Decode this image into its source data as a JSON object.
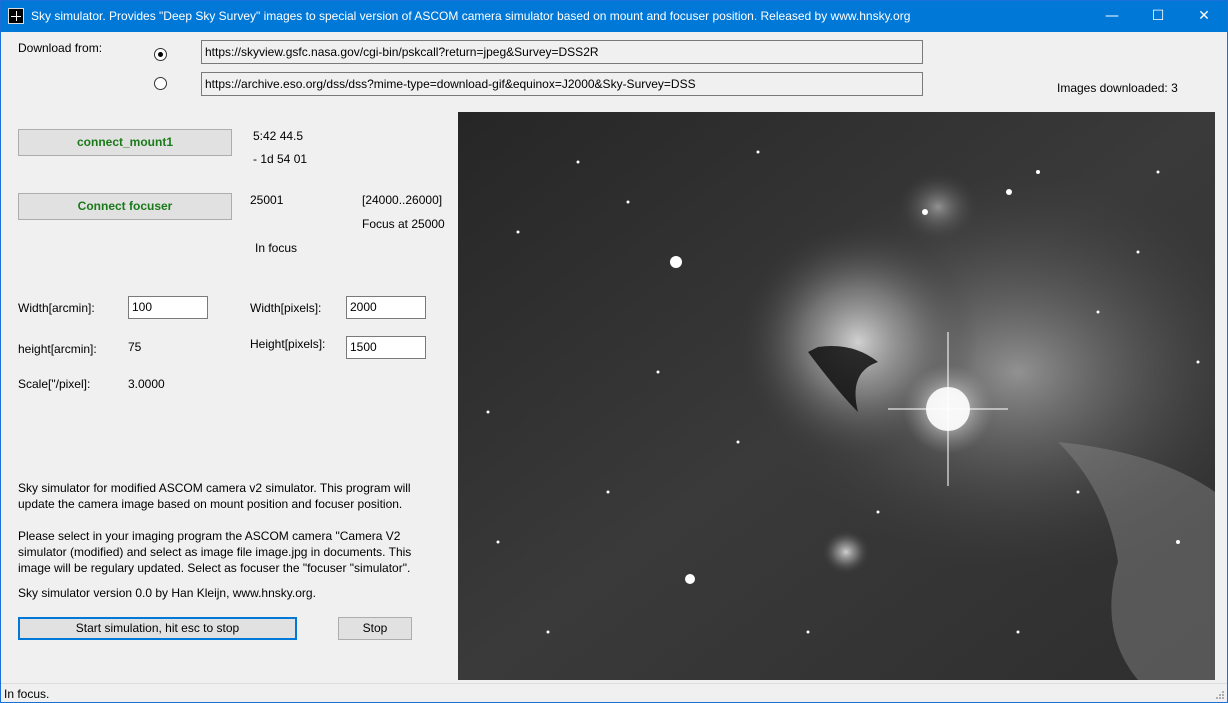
{
  "window": {
    "title": "Sky simulator. Provides  \"Deep Sky Survey\" images to special version of ASCOM camera simulator based on mount and focuser position. Released by www.hnsky.org",
    "minimize_glyph": "—",
    "maximize_glyph": "☐",
    "close_glyph": "✕"
  },
  "download": {
    "label": "Download from:",
    "url1": "https://skyview.gsfc.nasa.gov/cgi-bin/pskcall?return=jpeg&Survey=DSS2R",
    "url2": "https://archive.eso.org/dss/dss?mime-type=download-gif&equinox=J2000&Sky-Survey=DSS",
    "selected": 1,
    "images_downloaded": "Images downloaded: 3"
  },
  "mount": {
    "button_label": "connect_mount1",
    "ra": "5:42 44.5",
    "dec": "- 1d 54 01"
  },
  "focuser": {
    "button_label": "Connect focuser",
    "position": "25001",
    "range": "[24000..26000]",
    "focus_at": "Focus at 25000",
    "state": "In focus"
  },
  "dimensions": {
    "width_arcmin_label": "Width[arcmin]:",
    "width_arcmin_value": "100",
    "height_arcmin_label": "height[arcmin]:",
    "height_arcmin_value": "75",
    "scale_label": "Scale[\"/pixel]:",
    "scale_value": "3.0000",
    "width_pixels_label": "Width[pixels]:",
    "width_pixels_value": "2000",
    "height_pixels_label": "Height[pixels]:",
    "height_pixels_value": "1500"
  },
  "info": {
    "line1": "Sky simulator for modified ASCOM camera v2 simulator. This program will",
    "line2": "update the camera image based on mount position and focuser position.",
    "line3": "Please select in your imaging program the ASCOM camera \"Camera V2",
    "line4": "simulator (modified) and select as image file  image.jpg in documents. This",
    "line5": "image will be regulary updated. Select as focuser the \"focuser \"simulator\".",
    "version": "Sky simulator version 0.0   by Han Kleijn, www.hnsky.org."
  },
  "actions": {
    "start_label": "Start simulation, hit esc to stop",
    "stop_label": "Stop"
  },
  "status": {
    "text": "In focus."
  },
  "colors": {
    "titlebar": "#0078d7",
    "green_button_text": "#1a7a1a",
    "focus_border": "#0078d7"
  }
}
